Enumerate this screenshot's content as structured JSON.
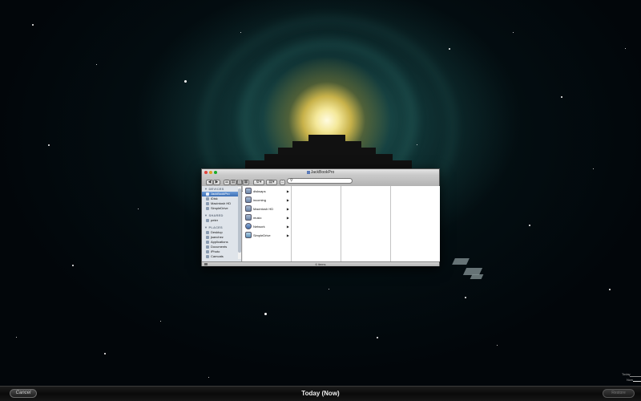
{
  "window": {
    "title": "JackBookPro",
    "search_placeholder": "",
    "status_text": "6 items"
  },
  "toolbar": {
    "back_label": "◀",
    "forward_label": "▶",
    "view_buttons": [
      "☰",
      "▤",
      "▥",
      "▦"
    ],
    "action_label": "⚙▾",
    "arrange_label": "▤▾",
    "eject_label": "⌂"
  },
  "sidebar": {
    "devices_header": "▼ DEVICES",
    "devices": [
      "JackBookPro",
      "iDisk",
      "Macintosh HD",
      "SimpleDrive"
    ],
    "shared_header": "▼ SHARED",
    "shared": [
      "peter"
    ],
    "places_header": "▼ PLACES",
    "places": [
      "Desktop",
      "jsanchez",
      "Applications",
      "Documents",
      "iPhoto",
      "Camcats"
    ]
  },
  "column1": {
    "items": [
      {
        "label": "disksaps",
        "icon": "drive-icon"
      },
      {
        "label": "incoming",
        "icon": "drive-icon"
      },
      {
        "label": "Macintosh HD",
        "icon": "drive-icon"
      },
      {
        "label": "music",
        "icon": "drive-icon"
      },
      {
        "label": "Network",
        "icon": "network-icon"
      },
      {
        "label": "SimpleDrive",
        "icon": "drive-icon"
      }
    ],
    "arrow": "▶"
  },
  "bottom_bar": {
    "cancel_label": "Cancel",
    "title": "Today (Now)",
    "restore_label": "Restore"
  },
  "timeline": {
    "today_label": "Today",
    "now_label": "Now"
  },
  "colors": {
    "selection": "#3c6fb5",
    "sidebar_bg": "#dfe4ea",
    "bar_bg": "#111111"
  }
}
